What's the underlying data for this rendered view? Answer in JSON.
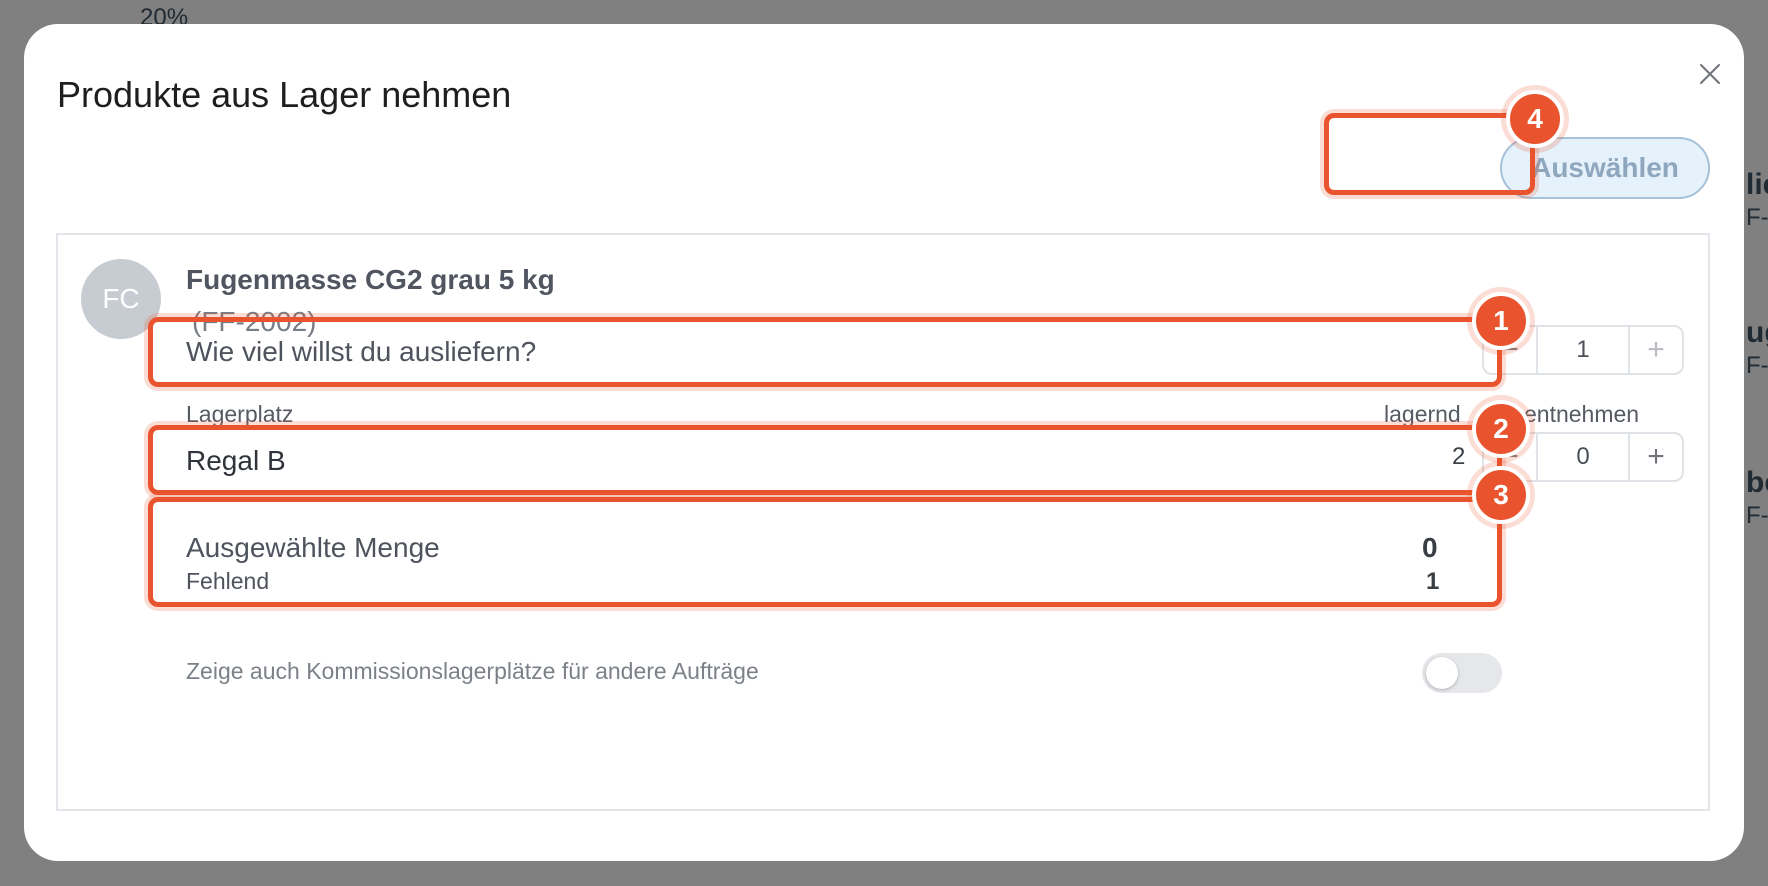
{
  "background": {
    "top_text": "20%",
    "right_fragments": [
      "lie",
      "F-",
      "ug",
      "F-",
      "be",
      "F-"
    ]
  },
  "dialog": {
    "title": "Produkte aus Lager nehmen",
    "close_icon": "close-icon",
    "select_button_label": "Auswählen"
  },
  "product": {
    "avatar_initials": "FC",
    "name": "Fugenmasse CG2 grau 5 kg",
    "sku": "(FF-2002)",
    "quantity_question": "Wie viel willst du ausliefern?",
    "quantity_value": "1"
  },
  "locations": {
    "header_location": "Lagerplatz",
    "header_stock": "lagernd",
    "header_take": "entnehmen",
    "rows": [
      {
        "name": "Regal B",
        "stock": "2",
        "take": "0"
      }
    ]
  },
  "summary": {
    "selected_label": "Ausgewählte Menge",
    "selected_value": "0",
    "missing_label": "Fehlend",
    "missing_value": "1"
  },
  "commission_toggle": {
    "label": "Zeige auch Kommissionslagerplätze für andere Aufträge",
    "enabled": false
  },
  "callouts": [
    "1",
    "2",
    "3",
    "4"
  ],
  "colors": {
    "highlight": "#e9542e",
    "button_bg": "#e5f1fb",
    "button_text": "#8fa7be",
    "overlay": "#808080"
  }
}
